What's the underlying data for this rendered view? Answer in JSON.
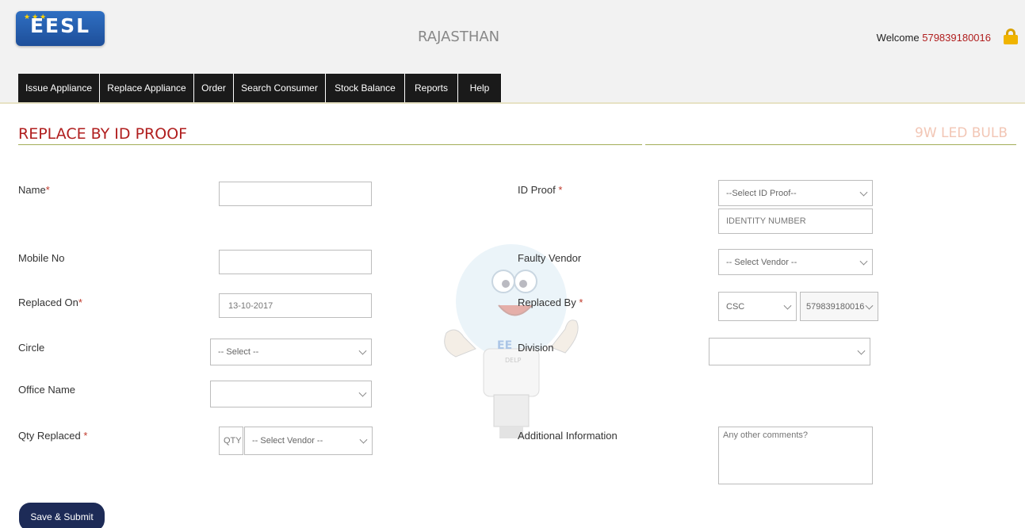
{
  "header": {
    "logo_text": "EESL",
    "state": "RAJASTHAN",
    "welcome_label": "Welcome",
    "user_id": "579839180016"
  },
  "nav": [
    {
      "label": "Issue Appliance"
    },
    {
      "label": "Replace Appliance"
    },
    {
      "label": "Order"
    },
    {
      "label": "Search Consumer"
    },
    {
      "label": "Stock Balance"
    },
    {
      "label": "Reports"
    },
    {
      "label": "Help"
    }
  ],
  "page": {
    "title": "REPLACE BY ID PROOF",
    "product": "9W LED BULB"
  },
  "form": {
    "name": {
      "label": "Name",
      "value": ""
    },
    "mobile": {
      "label": "Mobile No",
      "value": ""
    },
    "replaced_on": {
      "label": "Replaced On",
      "value": "13-10-2017"
    },
    "circle": {
      "label": "Circle",
      "value": "-- Select --"
    },
    "office_name": {
      "label": "Office Name",
      "value": ""
    },
    "qty_replaced": {
      "label": "Qty Replaced",
      "qty_placeholder": "QTY",
      "vendor_value": "-- Select Vendor --"
    },
    "id_proof": {
      "label": "ID Proof",
      "value": "--Select ID Proof--",
      "identity_placeholder": "IDENTITY NUMBER"
    },
    "faulty_vendor": {
      "label": "Faulty Vendor",
      "value": "-- Select Vendor --"
    },
    "replaced_by": {
      "label": "Replaced By",
      "type_value": "CSC",
      "id_value": "579839180016"
    },
    "division": {
      "label": "Division",
      "value": ""
    },
    "additional_info": {
      "label": "Additional Information",
      "placeholder": "Any other comments?"
    }
  },
  "mascot_text": "EE\nDELP",
  "actions": {
    "save_label": "Save & Submit"
  },
  "colors": {
    "accent": "#b01e1e",
    "nav_bg": "#1a1a1a",
    "button_bg": "#1d2b57",
    "underline": "#a3ad58"
  }
}
